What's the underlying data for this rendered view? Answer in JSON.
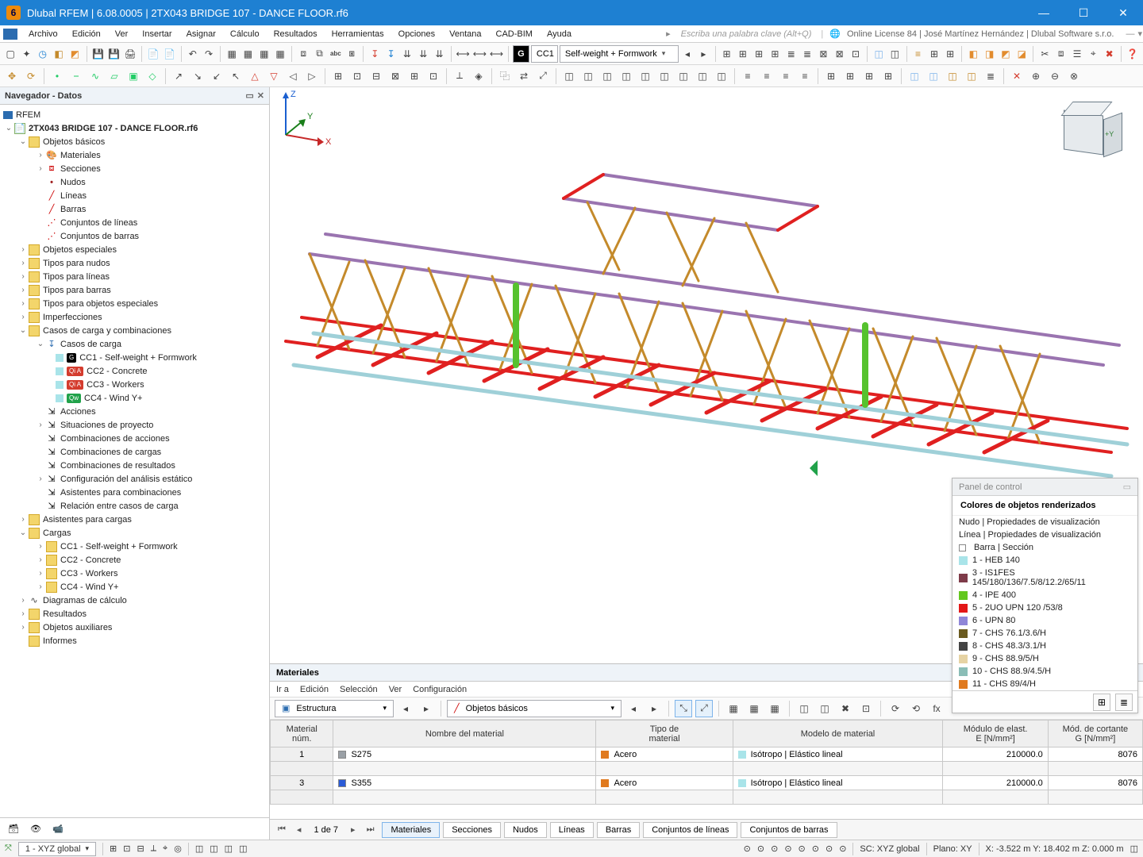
{
  "window": {
    "title": "Dlubal RFEM | 6.08.0005 | 2TX043 BRIDGE 107 - DANCE FLOOR.rf6"
  },
  "menubar": {
    "items": [
      "Archivo",
      "Edición",
      "Ver",
      "Insertar",
      "Asignar",
      "Cálculo",
      "Resultados",
      "Herramientas",
      "Opciones",
      "Ventana",
      "CAD-BIM",
      "Ayuda"
    ],
    "searchPlaceholder": "Escriba una palabra clave (Alt+Q)",
    "licenseText": "Online License 84 | José Martínez Hernández | Dlubal Software s.r.o."
  },
  "toolbar1": {
    "loadcase_short": "CC1",
    "loadcase_long": "Self-weight + Formwork"
  },
  "navigator": {
    "title": "Navegador - Datos",
    "root": "RFEM",
    "file": "2TX043 BRIDGE 107 - DANCE FLOOR.rf6",
    "basicObjects": "Objetos básicos",
    "basicChildren": [
      "Materiales",
      "Secciones",
      "Nudos",
      "Líneas",
      "Barras",
      "Conjuntos de líneas",
      "Conjuntos de barras"
    ],
    "categories1": [
      "Objetos especiales",
      "Tipos para nudos",
      "Tipos para líneas",
      "Tipos para barras",
      "Tipos para objetos especiales",
      "Imperfecciones"
    ],
    "loadCasesComb": "Casos de carga y combinaciones",
    "loadCases": "Casos de carga",
    "cc1": "CC1 - Self-weight + Formwork",
    "cc2": "CC2 - Concrete",
    "cc3": "CC3 - Workers",
    "cc4": "CC4 - Wind Y+",
    "lcBadges": {
      "g": "G",
      "qa": "Qi A",
      "qw": "Qw"
    },
    "afterLC": [
      "Acciones",
      "Situaciones de proyecto",
      "Combinaciones de acciones",
      "Combinaciones de cargas",
      "Combinaciones de resultados",
      "Configuración del análisis estático",
      "Asistentes para combinaciones",
      "Relación entre casos de carga"
    ],
    "categories2": [
      "Asistentes para cargas"
    ],
    "loads": "Cargas",
    "loadsChildren": [
      "CC1 - Self-weight + Formwork",
      "CC2 - Concrete",
      "CC3 - Workers",
      "CC4 - Wind Y+"
    ],
    "categories3": [
      "Diagramas de cálculo",
      "Resultados",
      "Objetos auxiliares",
      "Informes"
    ]
  },
  "axes": {
    "x": "X",
    "y": "Y",
    "z": "Z"
  },
  "materialsPanel": {
    "title": "Materiales",
    "menus": [
      "Ir a",
      "Edición",
      "Selección",
      "Ver",
      "Configuración"
    ],
    "combo1": "Estructura",
    "combo2": "Objetos básicos",
    "headers": {
      "num": "Material\nnúm.",
      "name": "Nombre del material",
      "type": "Tipo de\nmaterial",
      "model": "Modelo de material",
      "elast": "Módulo de elast.\nE [N/mm²]",
      "shear": "Mód. de cortante\nG [N/mm²]"
    },
    "rows": [
      {
        "num": "1",
        "name": "S275",
        "color": "#9aa0a6",
        "type": "Acero",
        "model": "Isótropo | Elástico lineal",
        "e": "210000.0",
        "g": "8076"
      },
      {
        "num": "3",
        "name": "S355",
        "color": "#2a5bd7",
        "type": "Acero",
        "model": "Isótropo | Elástico lineal",
        "e": "210000.0",
        "g": "8076"
      }
    ],
    "pager": "1 de 7",
    "tabs": [
      "Materiales",
      "Secciones",
      "Nudos",
      "Líneas",
      "Barras",
      "Conjuntos de líneas",
      "Conjuntos de barras"
    ]
  },
  "controlPanel": {
    "title": "Panel de control",
    "sectionTitle": "Colores de objetos renderizados",
    "groupLines": [
      "Nudo | Propiedades de visualización",
      "Línea | Propiedades de visualización",
      "Barra | Sección"
    ],
    "legend": [
      {
        "c": "#a9e4e9",
        "t": "1 - HEB 140"
      },
      {
        "c": "#7e3b49",
        "t": "3 - IS1FES 145/180/136/7.5/8/12.2/65/11"
      },
      {
        "c": "#63c71e",
        "t": "4 - IPE 400"
      },
      {
        "c": "#e31717",
        "t": "5 - 2UO UPN 120 /53/8"
      },
      {
        "c": "#8f86d8",
        "t": "6 - UPN 80"
      },
      {
        "c": "#6a5a1f",
        "t": "7 - CHS 76.1/3.6/H"
      },
      {
        "c": "#444444",
        "t": "8 - CHS 48.3/3.1/H"
      },
      {
        "c": "#e6d3a4",
        "t": "9 - CHS 88.9/5/H"
      },
      {
        "c": "#8abdb6",
        "t": "10 - CHS 88.9/4.5/H"
      },
      {
        "c": "#e07a1f",
        "t": "11 - CHS 89/4/H"
      }
    ]
  },
  "statusbar": {
    "cs": "1 - XYZ global",
    "sc": "SC: XYZ global",
    "plane": "Plano:  XY",
    "coords": "X: -3.522 m    Y: 18.402 m    Z: 0.000 m"
  }
}
